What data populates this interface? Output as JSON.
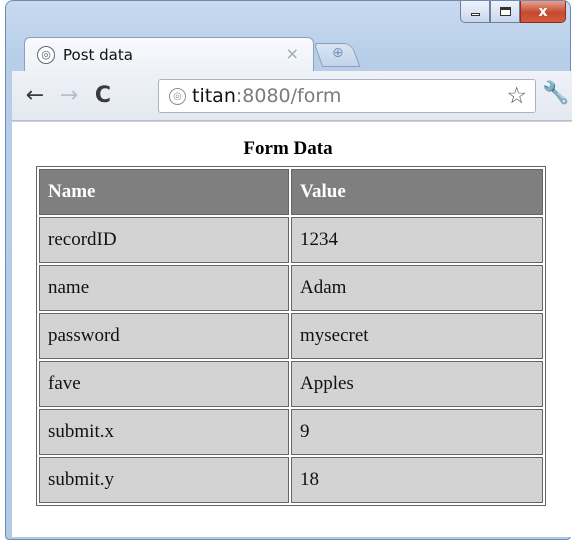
{
  "window": {
    "controls": {
      "minimize": "minimize",
      "maximize": "maximize",
      "close": "x"
    }
  },
  "tab": {
    "title": "Post data",
    "close_label": "×",
    "favicon": "globe-icon"
  },
  "toolbar": {
    "back": "←",
    "forward": "→",
    "reload": "C",
    "url_host": "titan",
    "url_rest": ":8080/form",
    "star": "☆",
    "wrench": "🔧"
  },
  "page": {
    "title": "Form Data",
    "table": {
      "headers": [
        "Name",
        "Value"
      ],
      "rows": [
        [
          "recordID",
          "1234"
        ],
        [
          "name",
          "Adam"
        ],
        [
          "password",
          "mysecret"
        ],
        [
          "fave",
          "Apples"
        ],
        [
          "submit.x",
          "9"
        ],
        [
          "submit.y",
          "18"
        ]
      ]
    }
  }
}
